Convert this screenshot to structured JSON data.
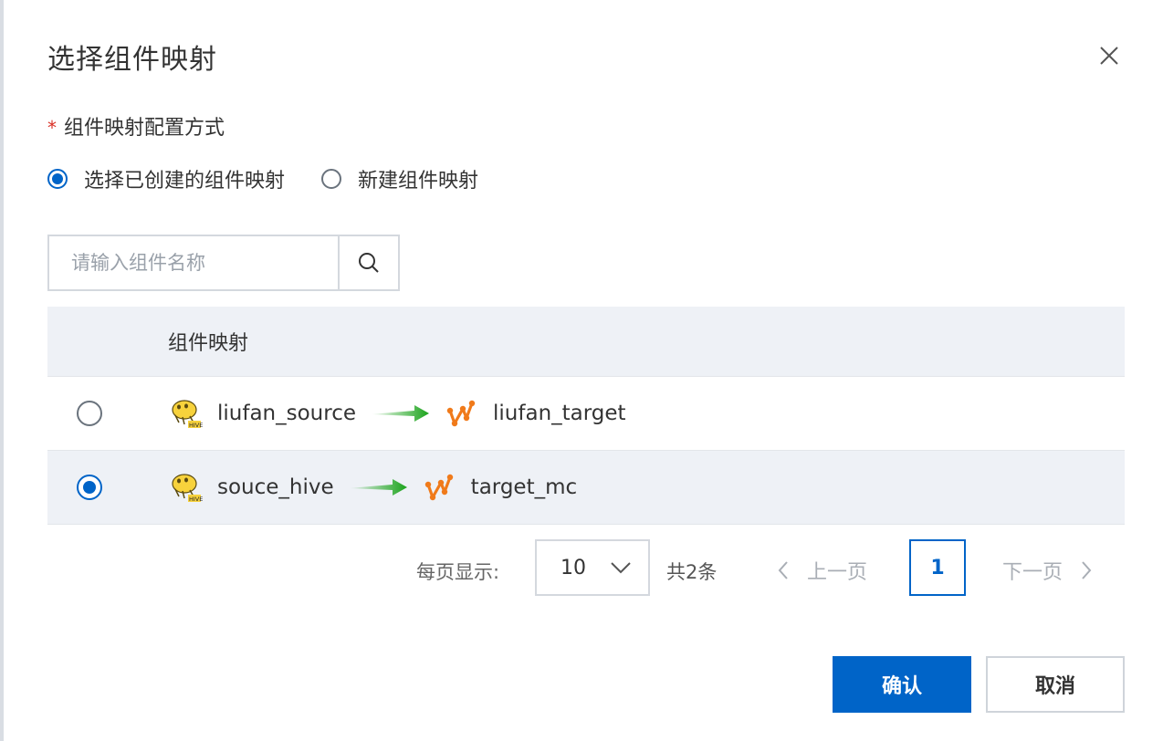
{
  "dialog": {
    "title": "选择组件映射",
    "field_label": "组件映射配置方式",
    "required_mark": "*",
    "options": [
      {
        "label": "选择已创建的组件映射",
        "checked": true
      },
      {
        "label": "新建组件映射",
        "checked": false
      }
    ],
    "search": {
      "placeholder": "请输入组件名称",
      "value": ""
    },
    "table": {
      "header": "组件映射",
      "rows": [
        {
          "source": "liufan_source",
          "target": "liufan_target",
          "selected": false,
          "source_icon": "hive-icon",
          "target_icon": "maxcompute-icon"
        },
        {
          "source": "souce_hive",
          "target": "target_mc",
          "selected": true,
          "source_icon": "hive-icon",
          "target_icon": "maxcompute-icon"
        }
      ]
    },
    "pagination": {
      "page_size_label": "每页显示:",
      "page_size": "10",
      "total": "共2条",
      "prev": "上一页",
      "next": "下一页",
      "current_page": "1"
    },
    "buttons": {
      "confirm": "确认",
      "cancel": "取消"
    }
  },
  "colors": {
    "primary": "#0064c8",
    "required": "#d93026",
    "arrow": "#1aa31a",
    "mc_icon": "#f07a1a"
  }
}
